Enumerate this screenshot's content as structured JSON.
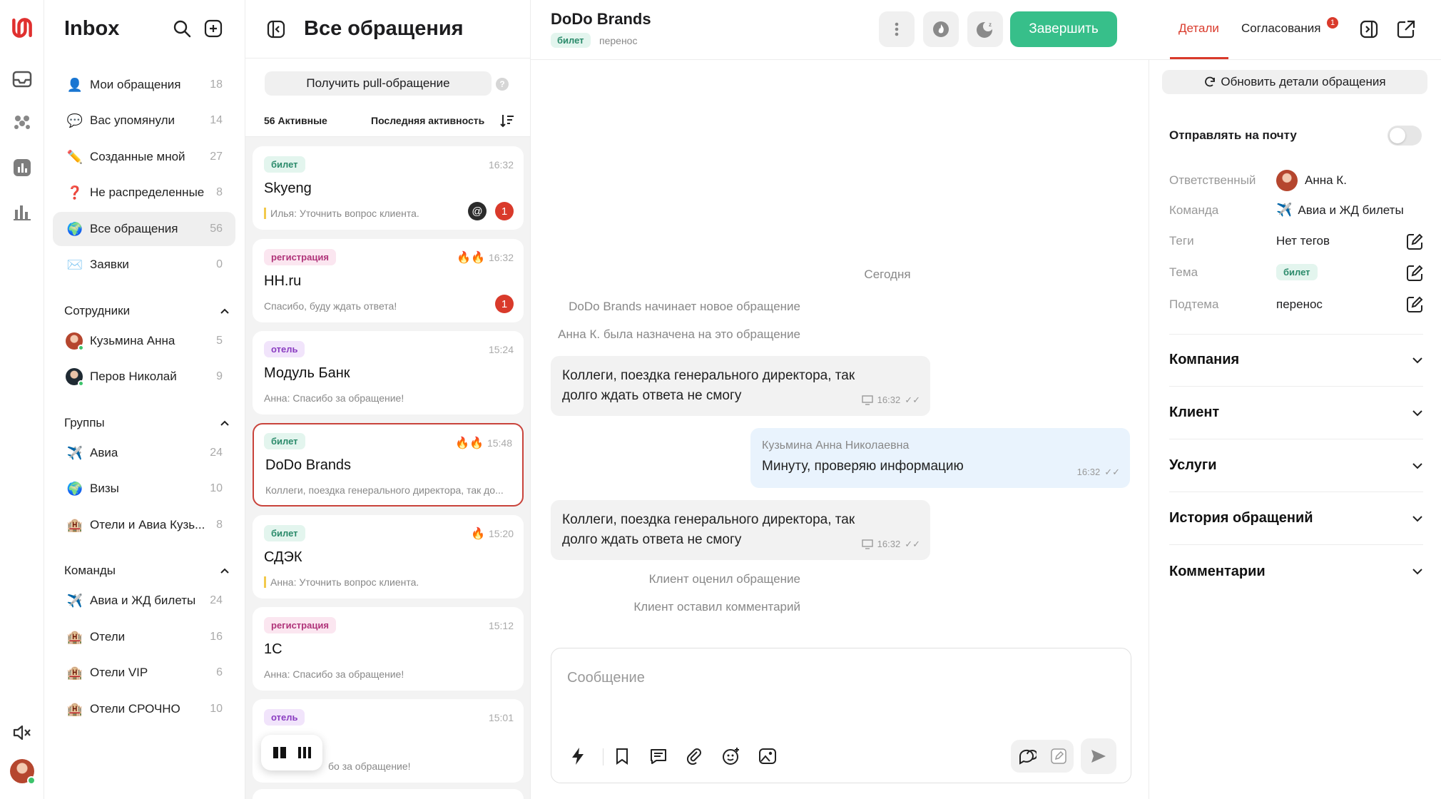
{
  "rail": {
    "logo_color": "#e0302f",
    "icons": [
      "inbox-icon",
      "team-icon",
      "reports-icon",
      "stats-icon"
    ],
    "mute_icon": "volume-mute-icon"
  },
  "nav": {
    "title": "Inbox",
    "items": [
      {
        "label": "Мои обращения",
        "count": "18",
        "emoji": "👤"
      },
      {
        "label": "Вас упомянули",
        "count": "14",
        "emoji": "💬"
      },
      {
        "label": "Созданные мной",
        "count": "27",
        "emoji": "✏️"
      },
      {
        "label": "Не распределенные",
        "count": "8",
        "emoji": "❓"
      },
      {
        "label": "Все обращения",
        "count": "56",
        "emoji": "🌍"
      },
      {
        "label": "Заявки",
        "count": "0",
        "emoji": "✉️"
      }
    ],
    "staff_title": "Сотрудники",
    "staff": [
      {
        "label": "Кузьмина Анна",
        "count": "5"
      },
      {
        "label": "Перов Николай",
        "count": "9"
      }
    ],
    "groups_title": "Группы",
    "groups": [
      {
        "label": "Авиа",
        "count": "24",
        "emoji": "✈️"
      },
      {
        "label": "Визы",
        "count": "10",
        "emoji": "🌍"
      },
      {
        "label": "Отели и Авиа Кузь...",
        "count": "8",
        "emoji": "🏨"
      }
    ],
    "teams_title": "Команды",
    "teams": [
      {
        "label": "Авиа и ЖД билеты",
        "count": "24",
        "emoji": "✈️"
      },
      {
        "label": "Отели",
        "count": "16",
        "emoji": "🏨"
      },
      {
        "label": "Отели VIP",
        "count": "6",
        "emoji": "🏨"
      },
      {
        "label": "Отели СРОЧНО",
        "count": "10",
        "emoji": "🏨"
      }
    ]
  },
  "list": {
    "title": "Все обращения",
    "pull_button": "Получить pull-обращение",
    "active_count": "56 Активные",
    "sort": "Последняя активность",
    "cards": [
      {
        "tag": "билет",
        "tag_type": "ticket",
        "time": "16:32",
        "name": "Skyeng",
        "preview": "Илья: Уточнить вопрос клиента.",
        "fires": "",
        "mention": "@",
        "badge": "1"
      },
      {
        "tag": "регистрация",
        "tag_type": "reg",
        "time": "16:32",
        "name": "HH.ru",
        "preview": "Спасибо, буду ждать ответа!",
        "fires": "🔥🔥",
        "mention": "",
        "badge": "1"
      },
      {
        "tag": "отель",
        "tag_type": "hotel",
        "time": "15:24",
        "name": "Модуль Банк",
        "preview": "Анна: Спасибо за обращение!",
        "fires": "",
        "mention": "",
        "badge": ""
      },
      {
        "tag": "билет",
        "tag_type": "ticket",
        "time": "15:48",
        "name": "DoDo Brands",
        "preview": "Коллеги, поездка генерального директора, так до...",
        "fires": "🔥🔥",
        "mention": "",
        "badge": ""
      },
      {
        "tag": "билет",
        "tag_type": "ticket",
        "time": "15:20",
        "name": "СДЭК",
        "preview": "Анна: Уточнить вопрос клиента.",
        "fires": "🔥",
        "mention": "",
        "badge": ""
      },
      {
        "tag": "регистрация",
        "tag_type": "reg",
        "time": "15:12",
        "name": "1С",
        "preview": "Анна: Спасибо за обращение!",
        "fires": "",
        "mention": "",
        "badge": ""
      },
      {
        "tag": "отель",
        "tag_type": "hotel",
        "time": "15:01",
        "name": "",
        "preview": "бо за обращение!",
        "fires": "",
        "mention": "",
        "badge": ""
      }
    ]
  },
  "chat": {
    "title": "DoDo Brands",
    "tag": "билет",
    "subtag": "перенос",
    "finish_button": "Завершить",
    "accent": "#37bf8a",
    "day": "Сегодня",
    "sys1": "DoDo Brands начинает новое обращение",
    "sys2": "Анна К. была назначена на это обращение",
    "msg1": {
      "line1": "Коллеги, поездка генерального директора, так",
      "line2": "долго ждать ответа не смогу",
      "time": "16:32"
    },
    "msg2": {
      "author": "Кузьмина Анна Николаевна",
      "text": "Минуту, проверяю информацию",
      "time": "16:32"
    },
    "msg3": {
      "line1": "Коллеги, поездка генерального директора, так",
      "line2": "долго ждать ответа не смогу",
      "time": "16:32"
    },
    "sys3": "Клиент оценил обращение",
    "sys4": "Клиент оставил комментарий",
    "placeholder": "Сообщение"
  },
  "details": {
    "tab_details": "Детали",
    "tab_approvals": "Согласования",
    "approvals_badge": "1",
    "refresh_button": "Обновить детали обращения",
    "email_toggle_label": "Отправлять на почту",
    "email_toggle_on": false,
    "fields": {
      "owner_label": "Ответственный",
      "owner": "Анна К.",
      "team_label": "Команда",
      "team": "Авиа и ЖД билеты",
      "tags_label": "Теги",
      "tags": "Нет тегов",
      "topic_label": "Тема",
      "topic": "билет",
      "subtopic_label": "Подтема",
      "subtopic": "перенос"
    },
    "sections": [
      "Компания",
      "Клиент",
      "Услуги",
      "История обращений",
      "Комментарии"
    ],
    "accent": "#e0302f"
  }
}
